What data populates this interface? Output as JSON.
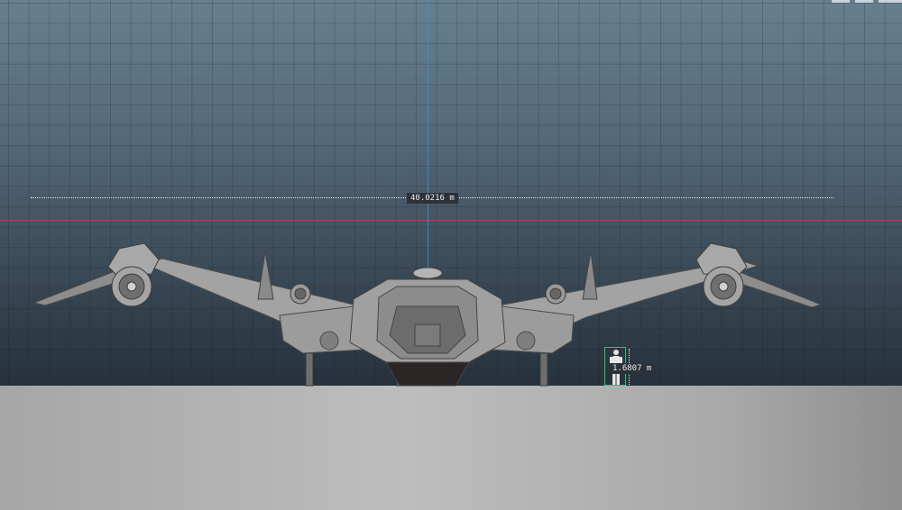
{
  "viewport": {
    "view": "front orthographic",
    "grid": "on"
  },
  "measurements": {
    "ship_width": "40.0216 m",
    "human_height": "1.6807 m"
  },
  "colors": {
    "y_axis": "#3f8fc7",
    "x_axis": "#b84a4a",
    "selection_box": "#2fbf7a",
    "label_background": "#2b3238"
  }
}
